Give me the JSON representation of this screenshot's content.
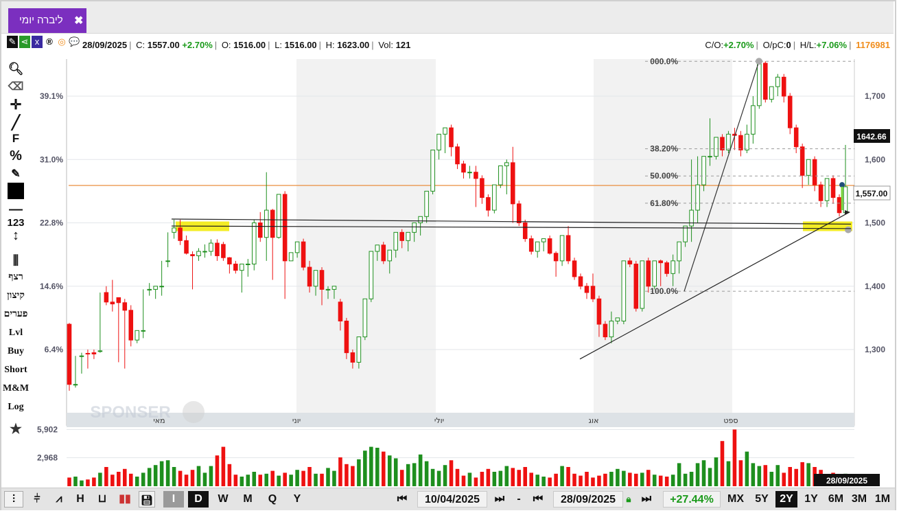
{
  "tab": {
    "title": "ליברה יומי",
    "close": "✖"
  },
  "info": {
    "date": "28/09/2025",
    "close_label": "C:",
    "close_value": "1557.00",
    "change": "+2.70%",
    "open_label": "O:",
    "open_value": "1516.00",
    "low_label": "L:",
    "low_value": "1516.00",
    "high_label": "H:",
    "high_value": "1623.00",
    "vol_label": "Vol:",
    "vol_value": "121",
    "co_label": "C/O:",
    "co_value": "+2.70%",
    "opc_label": "O/pC:",
    "opc_value": "0",
    "hl_label": "H/L:",
    "hl_value": "+7.06%",
    "code": "1176981"
  },
  "left_tools": {
    "numbers": "123",
    "t1": "רצף",
    "t2": "קיצון",
    "t3": "פערים",
    "t4": "Lvl",
    "t5": "Buy",
    "t6": "Short",
    "t7": "M&M",
    "t8": "Log",
    "f": "F",
    "pct": "%"
  },
  "watermark": "SPONSER",
  "colors": {
    "up": "#1e8f1e",
    "down": "#ee1111",
    "accent": "#7b2fbf",
    "level_line": "#e8822a",
    "highlight": "#f2ea00"
  },
  "chart_data": {
    "type": "candlestick",
    "x_labels": [
      "מאי",
      "יוני",
      "יולי",
      "אוג",
      "ספט"
    ],
    "y_right_ticks": [
      "1,300",
      "1,400",
      "1,500",
      "1,600",
      "1,700"
    ],
    "y_left_ticks": [
      "6.4%",
      "14.6%",
      "22.8%",
      "31.0%",
      "39.1%"
    ],
    "ylim": [
      1190,
      1760
    ],
    "last_price_label": "1642.66",
    "close_price_label": "1,557.00",
    "fib_levels": [
      {
        "label": "000.0%",
        "value": 1755
      },
      {
        "label": "38.20%",
        "value": 1617
      },
      {
        "label": "50.00%",
        "value": 1574
      },
      {
        "label": "61.80%",
        "value": 1531
      },
      {
        "label": "100.0%",
        "value": 1392
      }
    ],
    "horizontal_level": 1559,
    "ohlc": [
      [
        1340,
        1342,
        1245,
        1235
      ],
      [
        1245,
        1290,
        1245,
        1240
      ],
      [
        1290,
        1295,
        1290,
        1262
      ],
      [
        1294,
        1300,
        1293,
        1270
      ],
      [
        1295,
        1300,
        1293,
        1285
      ],
      [
        1298,
        1390,
        1298,
        1295
      ],
      [
        1390,
        1400,
        1375,
        1370
      ],
      [
        1375,
        1410,
        1372,
        1360
      ],
      [
        1382,
        1382,
        1374,
        1280
      ],
      [
        1374,
        1380,
        1362,
        1270
      ],
      [
        1362,
        1370,
        1315,
        1305
      ],
      [
        1315,
        1330,
        1330,
        1310
      ],
      [
        1330,
        1395,
        1330,
        1318
      ],
      [
        1395,
        1405,
        1395,
        1385
      ],
      [
        1395,
        1400,
        1400,
        1380
      ],
      [
        1400,
        1440,
        1400,
        1385
      ],
      [
        1440,
        1485,
        1440,
        1430
      ],
      [
        1485,
        1505,
        1492,
        1475
      ],
      [
        1492,
        1505,
        1472,
        1465
      ],
      [
        1472,
        1480,
        1452,
        1450
      ],
      [
        1450,
        1455,
        1448,
        1395
      ],
      [
        1448,
        1460,
        1455,
        1440
      ],
      [
        1455,
        1466,
        1455,
        1445
      ],
      [
        1455,
        1474,
        1468,
        1448
      ],
      [
        1468,
        1474,
        1448,
        1440
      ],
      [
        1466,
        1470,
        1445,
        1440
      ],
      [
        1445,
        1446,
        1435,
        1420
      ],
      [
        1435,
        1440,
        1425,
        1420
      ],
      [
        1425,
        1430,
        1435,
        1390
      ],
      [
        1435,
        1443,
        1435,
        1415
      ],
      [
        1435,
        1505,
        1500,
        1425
      ],
      [
        1500,
        1517,
        1477,
        1470
      ],
      [
        1477,
        1580,
        1520,
        1440
      ],
      [
        1520,
        1522,
        1477,
        1410
      ],
      [
        1477,
        1545,
        1545,
        1475
      ],
      [
        1545,
        1550,
        1440,
        1380
      ],
      [
        1440,
        1450,
        1453,
        1440
      ],
      [
        1453,
        1460,
        1470,
        1445
      ],
      [
        1470,
        1475,
        1430,
        1425
      ],
      [
        1430,
        1440,
        1400,
        1390
      ],
      [
        1400,
        1420,
        1425,
        1385
      ],
      [
        1425,
        1430,
        1395,
        1370
      ],
      [
        1395,
        1400,
        1395,
        1380
      ],
      [
        1395,
        1400,
        1400,
        1380
      ],
      [
        1375,
        1380,
        1345,
        1330
      ],
      [
        1345,
        1350,
        1295,
        1285
      ],
      [
        1295,
        1300,
        1280,
        1270
      ],
      [
        1280,
        1285,
        1320,
        1270
      ],
      [
        1320,
        1325,
        1380,
        1315
      ],
      [
        1380,
        1385,
        1455,
        1375
      ],
      [
        1455,
        1460,
        1465,
        1440
      ],
      [
        1465,
        1470,
        1440,
        1435
      ],
      [
        1440,
        1445,
        1457,
        1420
      ],
      [
        1457,
        1462,
        1485,
        1445
      ],
      [
        1485,
        1490,
        1472,
        1460
      ],
      [
        1472,
        1478,
        1485,
        1455
      ],
      [
        1485,
        1490,
        1500,
        1470
      ],
      [
        1500,
        1505,
        1510,
        1480
      ],
      [
        1510,
        1515,
        1550,
        1500
      ],
      [
        1550,
        1555,
        1615,
        1545
      ],
      [
        1615,
        1620,
        1640,
        1600
      ],
      [
        1640,
        1645,
        1650,
        1610
      ],
      [
        1650,
        1655,
        1620,
        1605
      ],
      [
        1620,
        1625,
        1593,
        1585
      ],
      [
        1593,
        1598,
        1580,
        1570
      ],
      [
        1580,
        1590,
        1580,
        1570
      ],
      [
        1580,
        1590,
        1570,
        1525
      ],
      [
        1570,
        1575,
        1540,
        1530
      ],
      [
        1540,
        1545,
        1520,
        1510
      ],
      [
        1520,
        1525,
        1560,
        1515
      ],
      [
        1560,
        1565,
        1590,
        1555
      ],
      [
        1590,
        1600,
        1595,
        1545
      ],
      [
        1595,
        1620,
        1530,
        1500
      ],
      [
        1530,
        1535,
        1500,
        1495
      ],
      [
        1500,
        1505,
        1475,
        1470
      ],
      [
        1475,
        1480,
        1455,
        1450
      ],
      [
        1455,
        1460,
        1470,
        1445
      ],
      [
        1470,
        1475,
        1475,
        1455
      ],
      [
        1475,
        1480,
        1452,
        1450
      ],
      [
        1452,
        1455,
        1440,
        1415
      ],
      [
        1440,
        1460,
        1480,
        1432
      ],
      [
        1480,
        1495,
        1440,
        1435
      ],
      [
        1440,
        1445,
        1415,
        1410
      ],
      [
        1415,
        1420,
        1400,
        1395
      ],
      [
        1400,
        1405,
        1390,
        1380
      ],
      [
        1400,
        1420,
        1380,
        1375
      ],
      [
        1380,
        1385,
        1340,
        1320
      ],
      [
        1340,
        1345,
        1320,
        1315
      ],
      [
        1320,
        1360,
        1345,
        1310
      ],
      [
        1345,
        1350,
        1350,
        1340
      ],
      [
        1345,
        1355,
        1440,
        1340
      ],
      [
        1440,
        1445,
        1435,
        1430
      ],
      [
        1435,
        1440,
        1365,
        1360
      ],
      [
        1365,
        1370,
        1440,
        1360
      ],
      [
        1440,
        1445,
        1400,
        1390
      ],
      [
        1400,
        1405,
        1440,
        1395
      ],
      [
        1440,
        1442,
        1437,
        1400
      ],
      [
        1437,
        1440,
        1420,
        1415
      ],
      [
        1420,
        1450,
        1440,
        1400
      ],
      [
        1440,
        1450,
        1470,
        1420
      ],
      [
        1470,
        1480,
        1495,
        1462
      ],
      [
        1495,
        1600,
        1520,
        1470
      ],
      [
        1520,
        1605,
        1560,
        1500
      ],
      [
        1560,
        1602,
        1605,
        1550
      ],
      [
        1605,
        1665,
        1605,
        1590
      ],
      [
        1605,
        1625,
        1635,
        1600
      ],
      [
        1635,
        1640,
        1615,
        1605
      ],
      [
        1615,
        1645,
        1640,
        1610
      ],
      [
        1640,
        1650,
        1638,
        1615
      ],
      [
        1638,
        1645,
        1615,
        1605
      ],
      [
        1615,
        1655,
        1640,
        1610
      ],
      [
        1640,
        1700,
        1685,
        1625
      ],
      [
        1685,
        1755,
        1752,
        1680
      ],
      [
        1752,
        1755,
        1695,
        1690
      ],
      [
        1695,
        1700,
        1715,
        1690
      ],
      [
        1715,
        1735,
        1730,
        1700
      ],
      [
        1730,
        1735,
        1700,
        1690
      ],
      [
        1700,
        1705,
        1650,
        1640
      ],
      [
        1650,
        1655,
        1620,
        1610
      ],
      [
        1620,
        1625,
        1575,
        1555
      ],
      [
        1575,
        1580,
        1600,
        1560
      ],
      [
        1600,
        1605,
        1560,
        1550
      ],
      [
        1560,
        1565,
        1535,
        1525
      ],
      [
        1535,
        1540,
        1570,
        1525
      ],
      [
        1570,
        1575,
        1540,
        1530
      ],
      [
        1540,
        1545,
        1516,
        1510
      ],
      [
        1516,
        1623,
        1557,
        1516
      ]
    ],
    "volume_ticks": [
      "5,902",
      "2,968"
    ],
    "volume_date_label": "28/09/2025",
    "volumes": [
      900,
      1000,
      600,
      700,
      900,
      1400,
      2000,
      1200,
      1500,
      1800,
      1300,
      1000,
      1400,
      1900,
      2200,
      2600,
      2700,
      2000,
      1600,
      1200,
      1700,
      2100,
      1400,
      2100,
      3200,
      4100,
      2300,
      1200,
      1000,
      1200,
      1500,
      1200,
      1300,
      1600,
      1100,
      1400,
      1200,
      1700,
      1600,
      2000,
      1300,
      1300,
      1900,
      1600,
      3000,
      2300,
      2100,
      2800,
      3700,
      4100,
      4000,
      3600,
      3200,
      2900,
      1700,
      2300,
      2400,
      3300,
      2600,
      1800,
      1600,
      2200,
      2700,
      1800,
      1100,
      1400,
      900,
      1500,
      1800,
      1500,
      1600,
      2100,
      1900,
      1700,
      2000,
      1400,
      1200,
      1000,
      900,
      1300,
      2100,
      2000,
      1300,
      1100,
      1500,
      900,
      1100,
      1300,
      1500,
      1800,
      1600,
      1400,
      1300,
      1400,
      1700,
      1200,
      1100,
      1000,
      1200,
      2400,
      1300,
      1500,
      2400,
      2700,
      1900,
      3000,
      4700,
      2600,
      5900,
      2700,
      3600,
      2400,
      2100,
      2200,
      1500,
      2200,
      1400,
      2000,
      1800,
      2500,
      2400,
      2000,
      1700,
      1200,
      1400,
      1100,
      1300,
      900,
      600,
      800,
      1000,
      500,
      1300,
      200
    ]
  },
  "bottom": {
    "period_buttons": [
      "I",
      "D",
      "W",
      "M",
      "Q",
      "Y"
    ],
    "from_date": "10/04/2025",
    "to_date": "28/09/2025",
    "sep": "-",
    "change": "+27.44%",
    "ranges": [
      "MX",
      "5Y",
      "2Y",
      "1Y",
      "6M",
      "3M",
      "1M"
    ],
    "active_range": "2Y",
    "nav_prev": "⏮",
    "nav_next": "⏭"
  }
}
